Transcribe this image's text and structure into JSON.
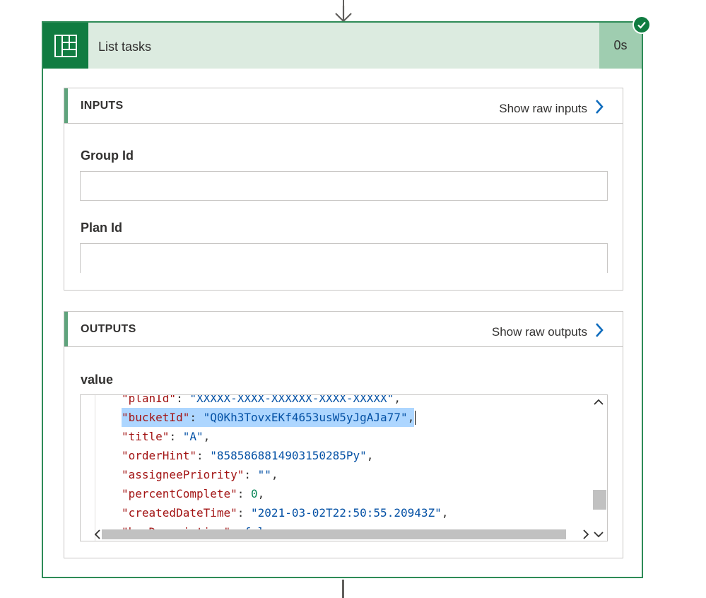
{
  "action": {
    "title": "List tasks",
    "duration": "0s",
    "status_icon": "check-circle-icon",
    "app_icon": "planner-icon"
  },
  "inputs": {
    "header": "INPUTS",
    "raw_link": "Show raw inputs",
    "fields": [
      {
        "label": "Group Id",
        "value": ""
      },
      {
        "label": "Plan Id",
        "value": ""
      }
    ]
  },
  "outputs": {
    "header": "OUTPUTS",
    "raw_link": "Show raw outputs",
    "value_label": "value",
    "code": {
      "lines": [
        {
          "key": "\"planId\"",
          "value": "\"XXXXX-XXXX-XXXXXX-XXXX-XXXXX\"",
          "type": "str",
          "trail": ","
        },
        {
          "key": "\"bucketId\"",
          "value": "\"Q0Kh3TovxEKf4653usW5yJgAJa77\"",
          "type": "str",
          "trail": ",",
          "selected": true
        },
        {
          "key": "\"title\"",
          "value": "\"A\"",
          "type": "str",
          "trail": ","
        },
        {
          "key": "\"orderHint\"",
          "value": "\"8585868814903150285Py\"",
          "type": "str",
          "trail": ","
        },
        {
          "key": "\"assigneePriority\"",
          "value": "\"\"",
          "type": "str",
          "trail": ","
        },
        {
          "key": "\"percentComplete\"",
          "value": "0",
          "type": "num",
          "trail": ","
        },
        {
          "key": "\"createdDateTime\"",
          "value": "\"2021-03-02T22:50:55.20943Z\"",
          "type": "str",
          "trail": ","
        },
        {
          "key": "\"hasDescription\"",
          "value": "false",
          "type": "bool",
          "trail": ","
        }
      ]
    }
  },
  "colors": {
    "accent_green": "#107c41",
    "header_bg": "#dcebe0",
    "link_blue": "#0f6cbd"
  }
}
